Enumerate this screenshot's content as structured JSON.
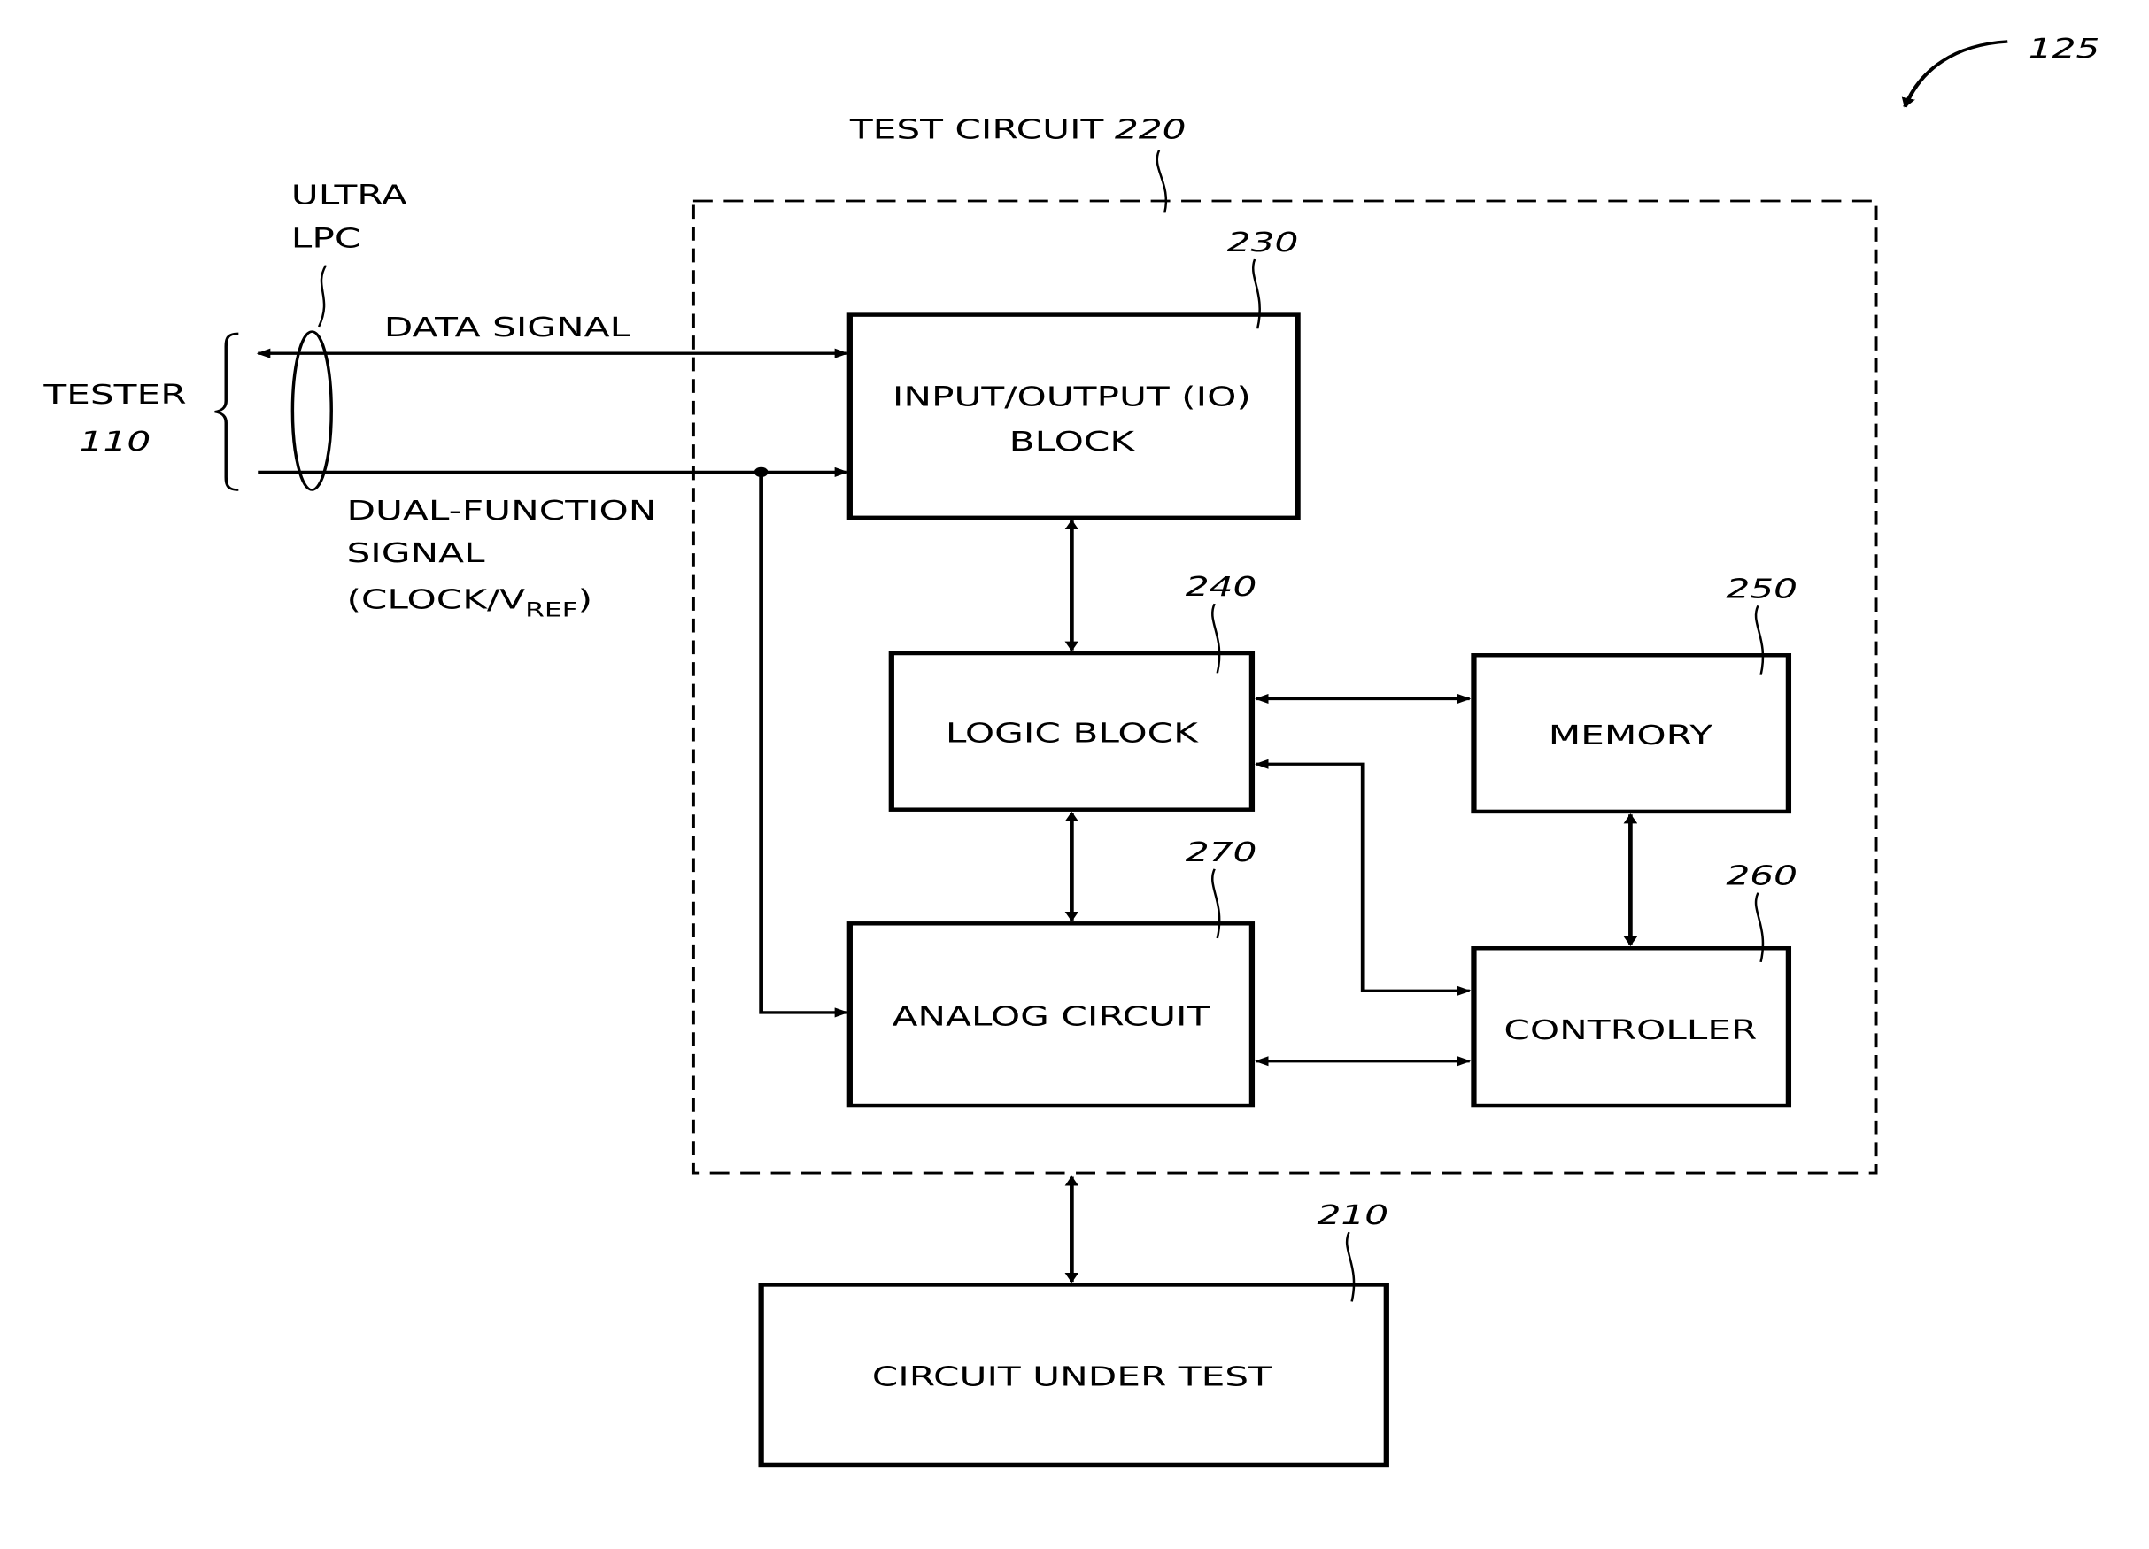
{
  "figure_ref": "125",
  "tester": {
    "label": "TESTER",
    "ref": "110"
  },
  "bus": {
    "line1": "ULTRA",
    "line2": "LPC"
  },
  "signals": {
    "data": "DATA SIGNAL",
    "dual_line1": "DUAL-FUNCTION",
    "dual_line2": "SIGNAL",
    "dual_line3_prefix": "(CLOCK/V",
    "dual_line3_sub": "REF",
    "dual_line3_suffix": ")"
  },
  "test_circuit": {
    "label": "TEST CIRCUIT",
    "ref": "220"
  },
  "blocks": {
    "io": {
      "line1": "INPUT/OUTPUT (IO)",
      "line2": "BLOCK",
      "ref": "230"
    },
    "logic": {
      "label": "LOGIC BLOCK",
      "ref": "240"
    },
    "memory": {
      "label": "MEMORY",
      "ref": "250"
    },
    "controller": {
      "label": "CONTROLLER",
      "ref": "260"
    },
    "analog": {
      "label": "ANALOG CIRCUIT",
      "ref": "270"
    },
    "cut": {
      "label": "CIRCUIT UNDER TEST",
      "ref": "210"
    }
  }
}
